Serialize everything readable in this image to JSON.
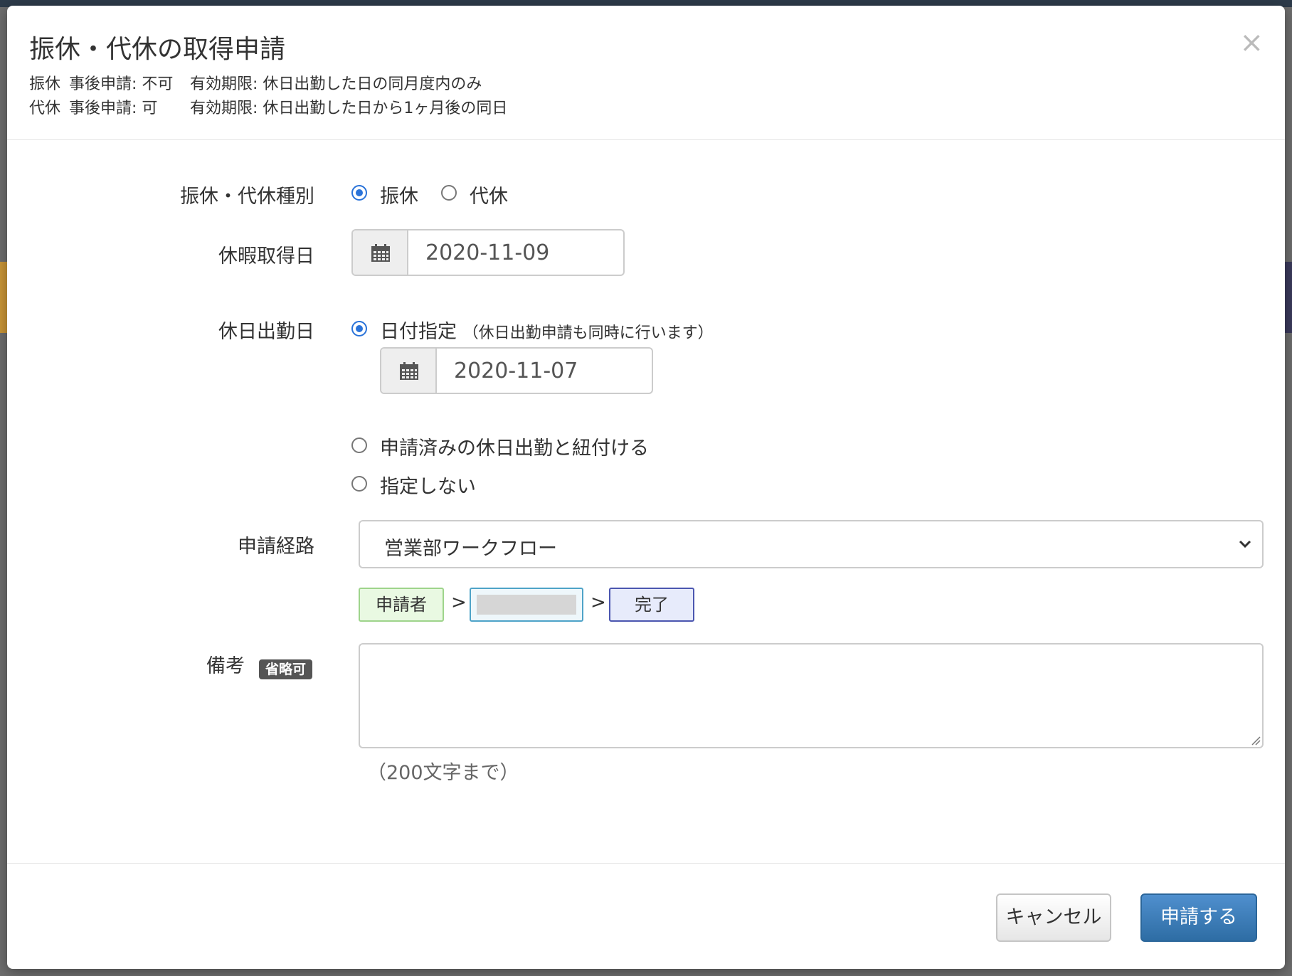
{
  "modal": {
    "title": "振休・代休の取得申請",
    "close_label": "×",
    "info": [
      {
        "type": "振休",
        "post_apply": "事後申請: 不可",
        "validity": "有効期限: 休日出勤した日の同月度内のみ"
      },
      {
        "type": "代休",
        "post_apply": "事後申請: 可",
        "validity": "有効期限: 休日出勤した日から1ヶ月後の同日"
      }
    ]
  },
  "form": {
    "kind": {
      "label": "振休・代休種別",
      "options": [
        "振休",
        "代休"
      ],
      "selected": "振休"
    },
    "leave_date": {
      "label": "休暇取得日",
      "value": "2020-11-09"
    },
    "holiday_work_date": {
      "label": "休日出勤日",
      "option_date": "日付指定",
      "option_date_note": "（休日出勤申請も同時に行います）",
      "date_value": "2020-11-07",
      "option_link": "申請済みの休日出勤と紐付ける",
      "option_none": "指定しない",
      "selected": "日付指定"
    },
    "route": {
      "label": "申請経路",
      "selected": "営業部ワークフロー",
      "flow": {
        "applicant": "申請者",
        "separator": ">",
        "done": "完了"
      }
    },
    "remarks": {
      "label": "備考",
      "badge": "省略可",
      "value": "",
      "hint": "（200文字まで）"
    }
  },
  "footer": {
    "cancel_label": "キャンセル",
    "submit_label": "申請する"
  },
  "colors": {
    "primary": "#2e6da4",
    "radio_checked": "#2a73d9",
    "applicant_chip": "#e9f9e2",
    "done_chip": "#e7ebfb"
  }
}
